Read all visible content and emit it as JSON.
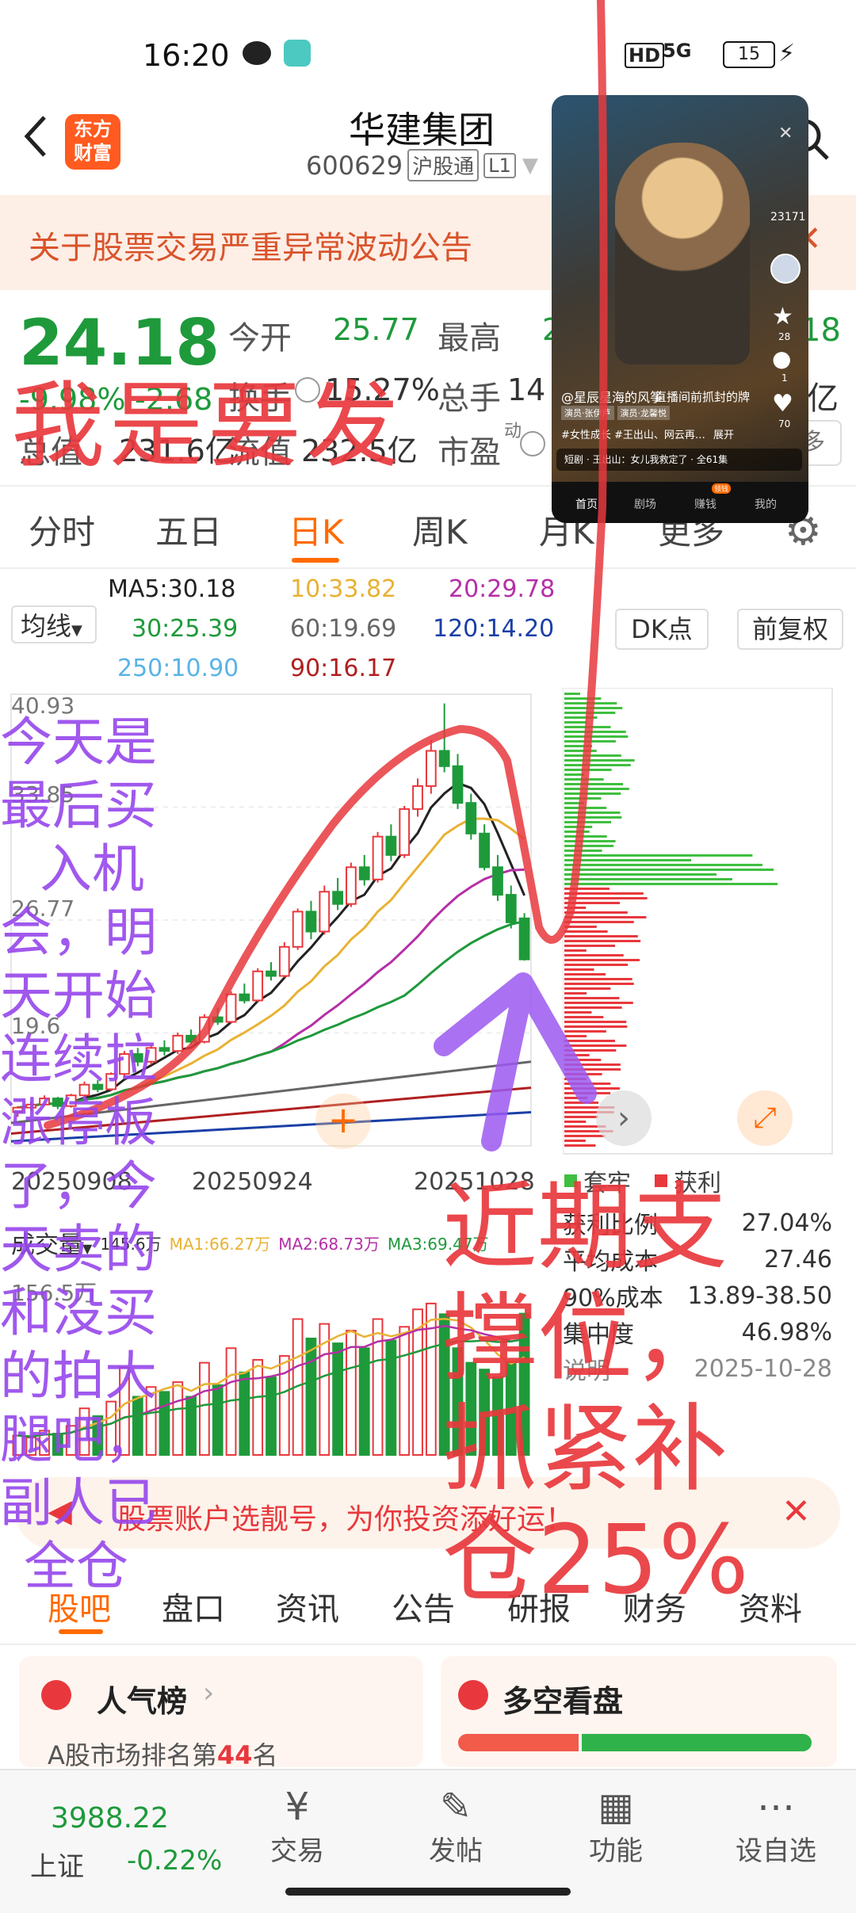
{
  "status_bar": {
    "time": "16:20",
    "hd": "HD",
    "signal": "5G",
    "battery": "15"
  },
  "header": {
    "back": "back",
    "logo_line1": "东方",
    "logo_line2": "财富",
    "stock_name": "华建集团",
    "stock_code": "600629",
    "tag_connect": "沪股通",
    "tag_level": "L1"
  },
  "notice": {
    "text": "关于股票交易严重异常波动公告"
  },
  "quote": {
    "price": "24.18",
    "change_pct": "-9.98%",
    "change": "-2.68",
    "open_label": "今开",
    "open_value": "25.77",
    "high_label": "最高",
    "high_value": "2",
    "turnover_label": "换手",
    "turnover_value": "15.27%",
    "volume_label": "总手",
    "volume_value": "14",
    "cap_label": "总值",
    "cap_value": "231.6亿",
    "float_label": "流值",
    "float_value": "232.5亿",
    "pe_label": "市盈",
    "pe_sup": "动",
    "right_value_1": "18",
    "right_value_2": "亿",
    "right_value_3": "多"
  },
  "tabs": [
    "分时",
    "五日",
    "日K",
    "周K",
    "月K",
    "更多"
  ],
  "active_tab": "日K",
  "ma_panel": {
    "selector": "均线",
    "ma5": "MA5:30.18",
    "ma10": "10:33.82",
    "ma20": "20:29.78",
    "ma30": "30:25.39",
    "ma60": "60:19.69",
    "ma120": "120:14.20",
    "ma250": "250:10.90",
    "ma90": "90:16.17",
    "dk_label": "DK点",
    "fq_label": "前复权"
  },
  "chart_data": {
    "type": "candlestick",
    "price_ticks": [
      "40.93",
      "33.85",
      "26.77",
      "19.6"
    ],
    "x_labels": [
      "20250908",
      "20250924",
      "20251028"
    ],
    "volume_max": "156.5万",
    "volume_legend": {
      "selector": "成交量",
      "v": "145.6万",
      "ma1": "MA1:66.27万",
      "ma2": "MA2:68.73万",
      "ma3": "MA3:69.47万"
    },
    "candles": [
      [
        14.2,
        14.6,
        13.9,
        14.5
      ],
      [
        14.5,
        14.9,
        14.3,
        14.7
      ],
      [
        14.7,
        15.3,
        14.6,
        15.1
      ],
      [
        15.1,
        15.2,
        14.4,
        14.6
      ],
      [
        14.6,
        15.4,
        14.5,
        15.3
      ],
      [
        15.3,
        16.2,
        15.1,
        16.0
      ],
      [
        16.0,
        16.3,
        15.5,
        15.7
      ],
      [
        15.7,
        16.8,
        15.6,
        16.7
      ],
      [
        16.7,
        18.2,
        16.5,
        18.0
      ],
      [
        18.0,
        18.4,
        17.2,
        17.5
      ],
      [
        17.5,
        18.6,
        17.3,
        18.4
      ],
      [
        18.4,
        18.9,
        17.9,
        18.2
      ],
      [
        18.2,
        19.4,
        18.0,
        19.2
      ],
      [
        19.2,
        19.6,
        18.6,
        18.8
      ],
      [
        18.8,
        20.6,
        18.7,
        20.4
      ],
      [
        20.4,
        21.0,
        19.9,
        20.1
      ],
      [
        20.1,
        22.1,
        20.0,
        21.9
      ],
      [
        21.9,
        22.6,
        21.3,
        21.5
      ],
      [
        21.5,
        23.6,
        21.4,
        23.4
      ],
      [
        23.4,
        24.0,
        22.8,
        23.1
      ],
      [
        23.1,
        25.3,
        23.0,
        25.0
      ],
      [
        25.0,
        27.5,
        24.8,
        27.3
      ],
      [
        27.3,
        28.0,
        25.5,
        26.0
      ],
      [
        26.0,
        29.0,
        25.8,
        28.6
      ],
      [
        28.6,
        29.5,
        27.4,
        27.8
      ],
      [
        27.8,
        30.5,
        27.6,
        30.2
      ],
      [
        30.2,
        31.0,
        29.0,
        29.4
      ],
      [
        29.4,
        32.5,
        29.2,
        32.2
      ],
      [
        32.2,
        33.0,
        30.6,
        31.0
      ],
      [
        31.0,
        34.2,
        30.8,
        34.0
      ],
      [
        34.0,
        36.0,
        33.5,
        35.5
      ],
      [
        35.5,
        38.5,
        35.0,
        37.8
      ],
      [
        37.8,
        40.9,
        36.4,
        36.8
      ],
      [
        36.8,
        37.6,
        34.0,
        34.4
      ],
      [
        34.4,
        35.0,
        32.0,
        32.4
      ],
      [
        32.4,
        33.0,
        30.0,
        30.2
      ],
      [
        30.2,
        31.0,
        28.0,
        28.4
      ],
      [
        28.4,
        29.0,
        26.2,
        26.6
      ],
      [
        26.86,
        27.2,
        24.1,
        24.18
      ]
    ],
    "volumes": [
      20,
      18,
      25,
      22,
      30,
      48,
      40,
      55,
      90,
      60,
      70,
      65,
      75,
      60,
      95,
      72,
      110,
      85,
      98,
      80,
      102,
      140,
      120,
      135,
      115,
      128,
      110,
      140,
      118,
      132,
      150,
      156,
      145,
      110,
      95,
      88,
      80,
      96,
      145.6
    ],
    "cost_distribution": {
      "legend_trap": "套牢",
      "legend_profit": "获利",
      "profit_ratio_label": "获利比例",
      "profit_ratio": "27.04%",
      "avg_cost_label": "平均成本",
      "avg_cost": "27.46",
      "cost90_label": "90%成本",
      "cost90": "13.89-38.50",
      "concentration_label": "集中度",
      "concentration": "46.98%",
      "note_label": "说明",
      "date": "2025-10-28"
    }
  },
  "promo": {
    "text": "股票账户选靓号，为你投资添好运！"
  },
  "sub_tabs": [
    "股吧",
    "盘口",
    "资讯",
    "公告",
    "研报",
    "财务",
    "资料"
  ],
  "cards": {
    "popularity_title": "人气榜",
    "rank_prefix": "A股市场排名第",
    "rank_value": "44",
    "rank_suffix": "名",
    "sentiment_title": "多空看盘"
  },
  "bottom_nav": {
    "index_value": "3988.22",
    "index_name": "上证",
    "index_change": "-0.22%",
    "trade": "交易",
    "post": "发帖",
    "function": "功能",
    "watchlist": "设自选"
  },
  "video_overlay": {
    "author": "@星辰星海的风筝",
    "caption": "直播间前抓封的牌",
    "tag1": "演员·张伊芦",
    "tag2": "演员·龙馨悦",
    "hashtags": "#女性成长 #王出山、网云再…",
    "expand": "展开",
    "drama": "短剧 · 王出山：女儿我救定了 · 全61集",
    "likes": "23171",
    "count_star": "28",
    "count_comment": "1",
    "count_heart": "70",
    "nav_home": "首页",
    "nav_theater": "剧场",
    "nav_earn": "赚钱",
    "nav_me": "我的",
    "earn_badge": "领钱"
  },
  "annotations": {
    "headline": "我是要发",
    "left_note": [
      "今天是",
      "最后买",
      "入机",
      "会，明",
      "天开始",
      "连续拉",
      "涨停板",
      "了，今",
      "天卖的",
      "和没买",
      "的拍大",
      "腿吧，",
      "副人已",
      "全仓"
    ],
    "right_note": [
      "近期支",
      "撑位，",
      "抓紧补",
      "仓25%"
    ]
  },
  "colors": {
    "up": "#e8383d",
    "down": "#1e9a3b",
    "accent": "#ff6a00",
    "notice_bg": "#fdeee6"
  }
}
